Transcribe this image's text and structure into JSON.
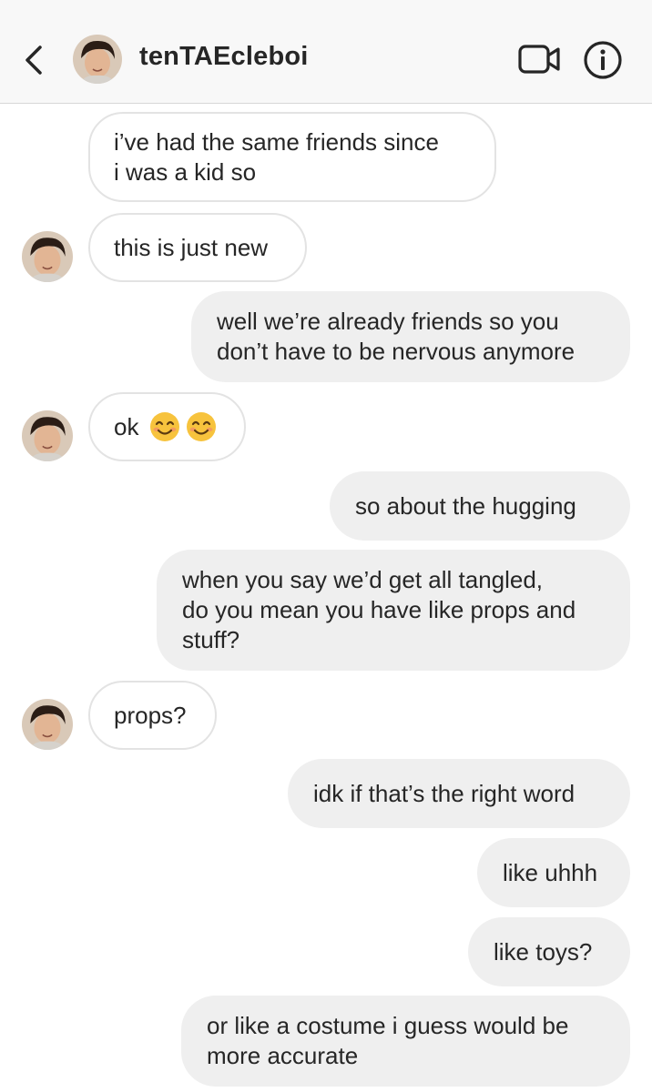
{
  "header": {
    "username": "tenTAEcleboi",
    "icons": [
      "back-chevron-icon",
      "video-call-icon",
      "info-icon"
    ]
  },
  "messages": [
    {
      "from": "them",
      "lines": [
        "i’ve had the same friends since",
        "i was a kid so"
      ]
    },
    {
      "from": "them",
      "lines": [
        "this is just new"
      ]
    },
    {
      "from": "me",
      "lines": [
        "well we’re already friends so you",
        "don’t have to be nervous anymore"
      ]
    },
    {
      "from": "them",
      "lines": [
        "ok"
      ],
      "emoji": [
        "smiling-face-emoji",
        "smiling-face-emoji"
      ]
    },
    {
      "from": "me",
      "lines": [
        "so about the hugging"
      ]
    },
    {
      "from": "me",
      "lines": [
        "when you say we’d get all tangled,",
        "do you mean you have like props and",
        "stuff?"
      ]
    },
    {
      "from": "them",
      "lines": [
        "props?"
      ]
    },
    {
      "from": "me",
      "lines": [
        "idk if that’s the right word"
      ]
    },
    {
      "from": "me",
      "lines": [
        "like uhhh"
      ]
    },
    {
      "from": "me",
      "lines": [
        "like toys?"
      ]
    },
    {
      "from": "me",
      "lines": [
        "or like a costume i guess would be",
        "more accurate"
      ]
    }
  ],
  "colors": {
    "header_bg": "#f8f8f8",
    "sent_bubble": "#efefef",
    "received_border": "#e3e3e3",
    "text": "#262626"
  }
}
